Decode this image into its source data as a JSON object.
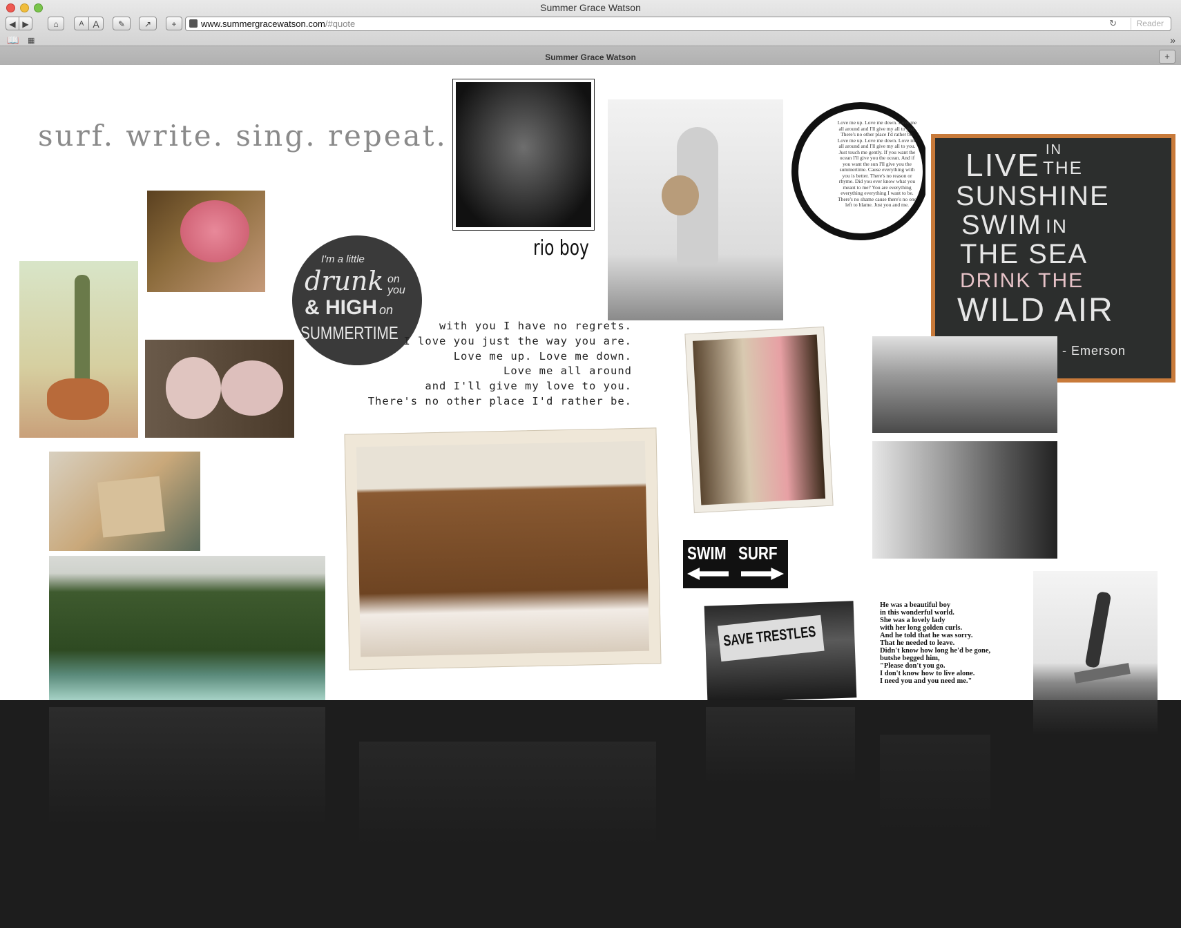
{
  "window": {
    "title": "Summer Grace Watson"
  },
  "toolbar": {
    "back_label": "◀",
    "forward_label": "▶",
    "home_label": "⌂",
    "font_smaller_label": "A",
    "font_larger_label": "A",
    "edit_label": "✎",
    "share_label": "↗",
    "add_label": "+"
  },
  "address_bar": {
    "domain": "www.summergracewatson.com",
    "path": "/#quote",
    "reader_label": "Reader",
    "reload_icon": "↻"
  },
  "bookmarks": {
    "overflow_label": "»"
  },
  "tab": {
    "title": "Summer Grace Watson",
    "new_tab_label": "+"
  },
  "collage": {
    "tagline": "surf. write. sing. repeat.",
    "dog_caption": "rio boy",
    "drunk_circle": {
      "line1": "I'm a little",
      "line2": "drunk",
      "line3": "on you",
      "line4": "& HIGH",
      "line5": "on",
      "line6": "SUMMERTIME"
    },
    "poem_lines": [
      "with you I have no regrets.",
      "I love you just the way you are.",
      "Love me up. Love me down.",
      "Love me all around",
      "and I'll give my love to you.",
      "There's no other place I'd rather be."
    ],
    "circle_poem": "Love me up. Love me down. Love me all around and I'll give my all to you. There's no other place I'd rather be. Love me up. Love me down. Love me all around and I'll give my all to you. Just touch me gently. If you want the ocean I'll give you the ocean. And if you want the sun I'll give you the summertime. Cause everything with you is better. There's no reason or rhyme. Did you ever know what you meant to me? You are everything everything everything I want to be. There's no shame cause there's no one left to blame. Just you and me.",
    "chalkboard": {
      "line1": "LIVE",
      "line1b": "IN",
      "line1c": "THE",
      "line2": "SUNSHINE",
      "line3": "SWIM",
      "line3b": "IN",
      "line4": "THE SEA",
      "line5": "DRINK THE",
      "line6": "WILD AIR",
      "attribution": "- Emerson"
    },
    "sign_swim": "SWIM",
    "sign_surf": "SURF",
    "save_trestles": "SAVE TRESTLES",
    "boy_poem_lines": [
      "He was a beautiful boy",
      "in this wonderful world.",
      "She was a lovely lady",
      "with her long golden curls.",
      "And he told that he was sorry.",
      "That he needed to leave.",
      "Didn't know how long he'd be gone,",
      "butshe begged him,",
      "\"Please don't you go.",
      "I don't know how to live alone.",
      "I need you and you need me.\""
    ]
  }
}
